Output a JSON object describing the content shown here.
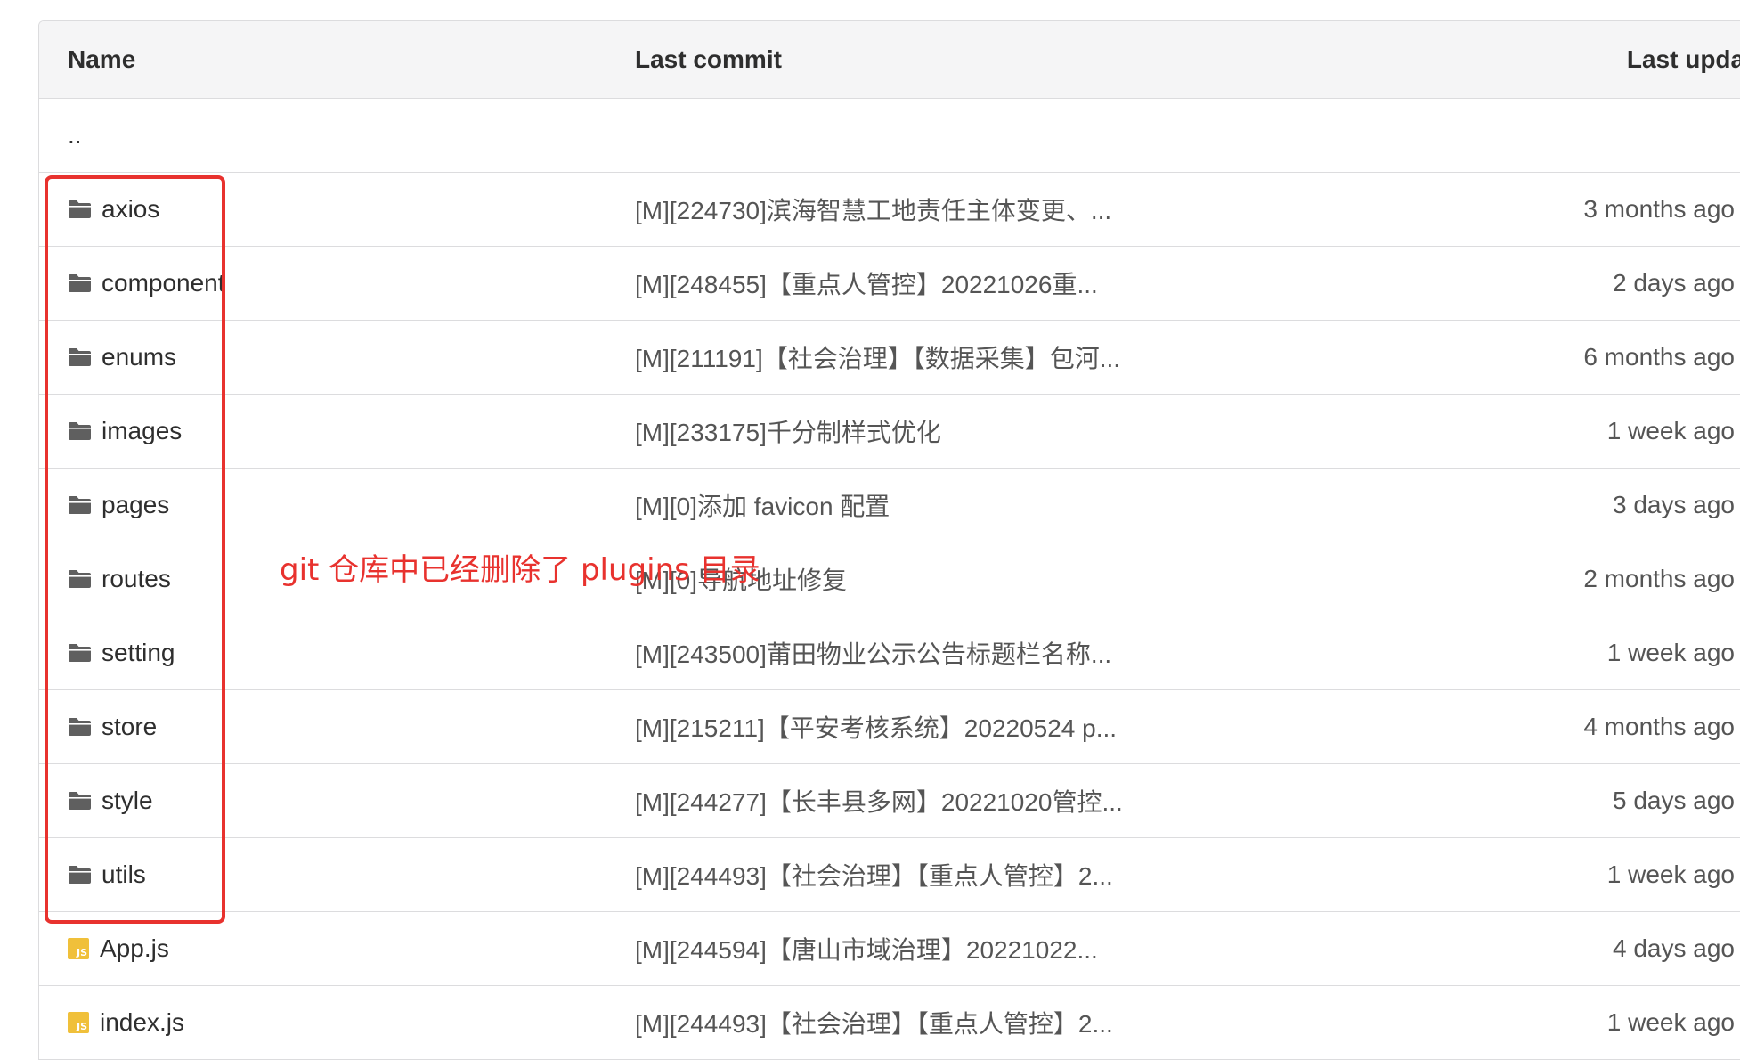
{
  "table": {
    "headers": {
      "name": "Name",
      "last_commit": "Last commit",
      "last_update": "Last update"
    },
    "parent_row": {
      "name": ".."
    },
    "rows": [
      {
        "type": "folder",
        "name": "axios",
        "commit": "[M][224730]滨海智慧工地责任主体变更、...",
        "updated": "3 months ago"
      },
      {
        "type": "folder",
        "name": "component",
        "commit": "[M][248455]【重点人管控】20221026重...",
        "updated": "2 days ago"
      },
      {
        "type": "folder",
        "name": "enums",
        "commit": "[M][211191]【社会治理】【数据采集】包河...",
        "updated": "6 months ago"
      },
      {
        "type": "folder",
        "name": "images",
        "commit": "[M][233175]千分制样式优化",
        "updated": "1 week ago"
      },
      {
        "type": "folder",
        "name": "pages",
        "commit": "[M][0]添加 favicon 配置",
        "updated": "3 days ago"
      },
      {
        "type": "folder",
        "name": "routes",
        "commit": "[M][0]导航地址修复",
        "updated": "2 months ago"
      },
      {
        "type": "folder",
        "name": "setting",
        "commit": "[M][243500]莆田物业公示公告标题栏名称...",
        "updated": "1 week ago"
      },
      {
        "type": "folder",
        "name": "store",
        "commit": "[M][215211]【平安考核系统】20220524 p...",
        "updated": "4 months ago"
      },
      {
        "type": "folder",
        "name": "style",
        "commit": "[M][244277]【长丰县多网】20221020管控...",
        "updated": "5 days ago"
      },
      {
        "type": "folder",
        "name": "utils",
        "commit": "[M][244493]【社会治理】【重点人管控】2...",
        "updated": "1 week ago"
      },
      {
        "type": "file",
        "name": "App.js",
        "commit": "[M][244594]【唐山市域治理】20221022...",
        "updated": "4 days ago"
      },
      {
        "type": "file",
        "name": "index.js",
        "commit": "[M][244493]【社会治理】【重点人管控】2...",
        "updated": "1 week ago"
      }
    ]
  },
  "annotation": {
    "text": "git 仓库中已经删除了 plugins 目录",
    "color": "#e8322e"
  },
  "icons": {
    "folder": "folder-icon",
    "file": "js-file-icon"
  },
  "file_badge": "JS"
}
